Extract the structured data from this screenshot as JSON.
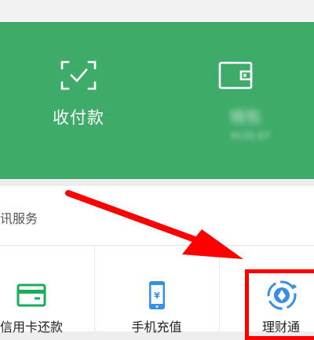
{
  "top_panel": {
    "pay_label": "收付款",
    "wallet_label": "钱包",
    "wallet_balance": "¥132.07"
  },
  "services": {
    "section_title": "讯服务",
    "items": [
      {
        "label": "信用卡还款",
        "icon": "credit-card-icon"
      },
      {
        "label": "手机充值",
        "icon": "phone-recharge-icon"
      },
      {
        "label": "理财通",
        "icon": "licaitong-icon"
      }
    ]
  },
  "colors": {
    "panel_green": "#3fab6a",
    "annotation_red": "#ff0000",
    "icon_green": "#1aad5b",
    "icon_blue": "#3a8ee6"
  }
}
